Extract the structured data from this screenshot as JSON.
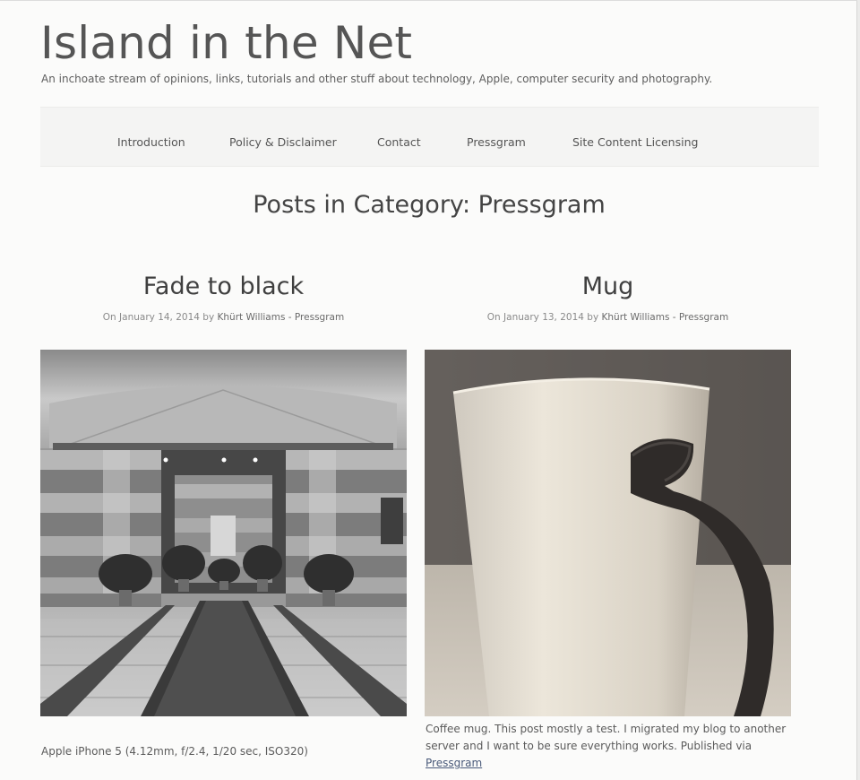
{
  "site": {
    "title": "Island in the Net",
    "tagline": "An inchoate stream of opinions, links, tutorials and other stuff about technology, Apple, computer security and photography."
  },
  "nav": {
    "items": [
      {
        "label": "Introduction"
      },
      {
        "label": "Policy & Disclaimer"
      },
      {
        "label": "Contact"
      },
      {
        "label": "Pressgram"
      },
      {
        "label": "Site Content Licensing"
      }
    ]
  },
  "archive": {
    "title": "Posts in Category: Pressgram"
  },
  "posts": [
    {
      "title": "Fade to black",
      "meta_prefix": "On January 14, 2014 by",
      "author": "Khürt Williams - Pressgram",
      "caption": "Apple iPhone 5 (4.12mm, f/2.4, 1/20 sec, ISO320)",
      "image": "lobby-photo"
    },
    {
      "title": "Mug",
      "meta_prefix": "On January 13, 2014 by",
      "author": "Khürt Williams - Pressgram",
      "caption_text": "Coffee mug. This post mostly a test. I migrated my blog to another server and I want to be sure everything works. Published via",
      "caption_link": "Pressgram",
      "image": "mug-photo"
    }
  ],
  "colors": {
    "page_bg": "#fbfbfa",
    "nav_bg": "#f4f4f3",
    "text": "#4a4a4a",
    "meta": "#8a8a8a"
  }
}
